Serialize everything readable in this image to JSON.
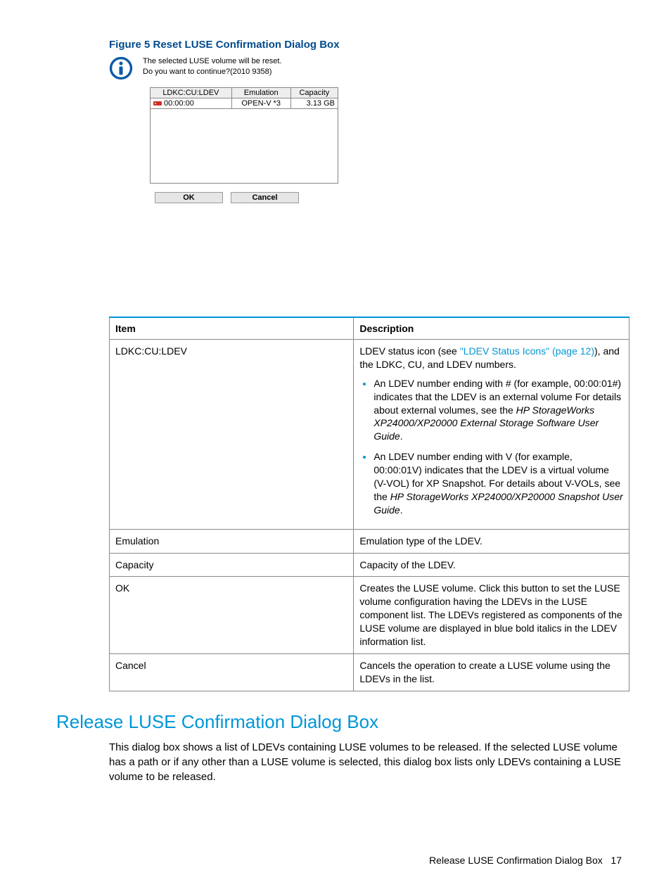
{
  "figure": {
    "caption": "Figure 5 Reset LUSE Confirmation Dialog Box"
  },
  "dialog": {
    "msg_line1": "The selected LUSE volume will be reset.",
    "msg_line2": "Do you want to continue?(2010 9358)",
    "cols": {
      "c1": "LDKC:CU:LDEV",
      "c2": "Emulation",
      "c3": "Capacity"
    },
    "row": {
      "ldev": "00:00:00",
      "emu": "OPEN-V *3",
      "cap": "3.13 GB"
    },
    "ok_label": "OK",
    "cancel_label": "Cancel"
  },
  "table": {
    "head_item": "Item",
    "head_desc": "Description",
    "rows": [
      {
        "item": "LDKC:CU:LDEV",
        "desc_pre": "LDEV status icon (see ",
        "desc_link": "\"LDEV Status Icons\" (page 12)",
        "desc_post": "), and the LDKC, CU, and LDEV numbers.",
        "bullet1_pre": "An LDEV number ending with # (for example, 00:00:01#) indicates that the LDEV is an external volume For details about external volumes, see the ",
        "bullet1_it": "HP StorageWorks XP24000/XP20000 External Storage Software User Guide",
        "bullet1_post": ".",
        "bullet2_pre": "An LDEV number ending with V (for example, 00:00:01V) indicates that the LDEV is a virtual volume (V-VOL) for XP Snapshot. For details about V-VOLs, see the ",
        "bullet2_it": "HP StorageWorks XP24000/XP20000 Snapshot User Guide",
        "bullet2_post": "."
      },
      {
        "item": "Emulation",
        "desc": "Emulation type of the LDEV."
      },
      {
        "item": "Capacity",
        "desc": "Capacity of the LDEV."
      },
      {
        "item": "OK",
        "desc": "Creates the LUSE volume. Click this button to set the LUSE volume configuration having the LDEVs in the LUSE component list. The LDEVs registered as components of the LUSE volume are displayed in blue bold italics in the LDEV information list."
      },
      {
        "item": "Cancel",
        "desc": "Cancels the operation to create a LUSE volume using the LDEVs in the list."
      }
    ]
  },
  "section": {
    "heading": "Release LUSE Confirmation Dialog Box",
    "body": "This dialog box shows a list of LDEVs containing LUSE volumes to be released. If the selected LUSE volume has a path or if any other than a LUSE volume is selected, this dialog box lists only LDEVs containing a LUSE volume to be released."
  },
  "footer": {
    "text": "Release LUSE Confirmation Dialog Box",
    "page": "17"
  }
}
